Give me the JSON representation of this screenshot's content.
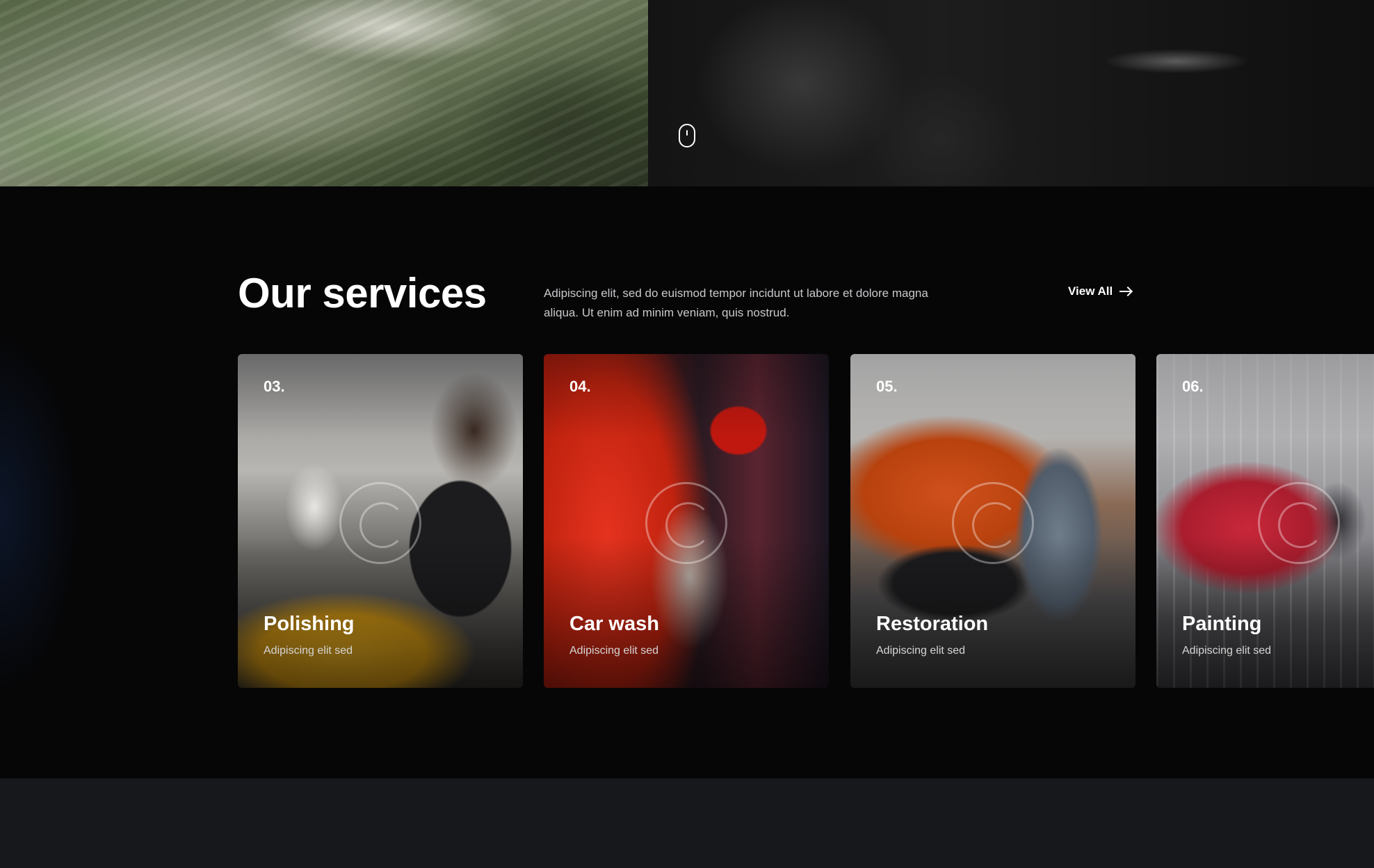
{
  "hero": {
    "scroll_icon": "mouse-icon"
  },
  "services": {
    "title": "Our services",
    "description": "Adipiscing elit, sed do euismod tempor incidunt ut labore et dolore magna aliqua. Ut enim ad minim veniam, quis nostrud.",
    "view_all_label": "View All",
    "view_all_icon": "arrow-right-icon",
    "cards": [
      {
        "number": "03.",
        "title": "Polishing",
        "subtitle": "Adipiscing elit sed"
      },
      {
        "number": "04.",
        "title": "Car wash",
        "subtitle": "Adipiscing elit sed"
      },
      {
        "number": "05.",
        "title": "Restoration",
        "subtitle": "Adipiscing elit sed"
      },
      {
        "number": "06.",
        "title": "Painting",
        "subtitle": "Adipiscing elit sed"
      }
    ]
  },
  "colors": {
    "background": "#060607",
    "footer_background": "#17181b",
    "text_primary": "#ffffff",
    "text_secondary": "#c9c9cc"
  }
}
